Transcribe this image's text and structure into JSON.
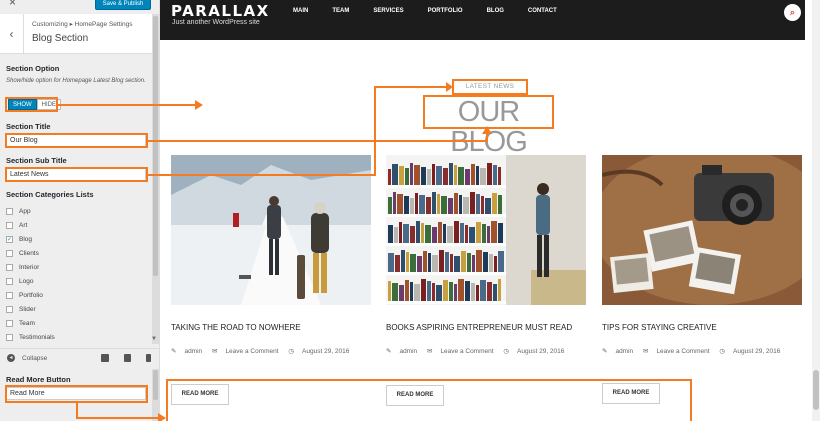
{
  "sidebar": {
    "close_icon": "close-icon",
    "save_label": "Save & Publish",
    "breadcrumb": "Customizing ▸ HomePage Settings",
    "section_title": "Blog Section",
    "section_option_label": "Section Option",
    "section_option_desc": "Show/hide option for Homepage Latest Blog section.",
    "toggle_show": "SHOW",
    "toggle_hide": "HIDE",
    "section_title_label": "Section Title",
    "section_title_value": "Our Blog",
    "section_subtitle_label": "Section Sub Title",
    "section_subtitle_value": "Latest News",
    "categories_label": "Section Categories Lists",
    "categories": [
      {
        "label": "App",
        "checked": false
      },
      {
        "label": "Art",
        "checked": false
      },
      {
        "label": "Blog",
        "checked": true
      },
      {
        "label": "Clients",
        "checked": false
      },
      {
        "label": "Interior",
        "checked": false
      },
      {
        "label": "Logo",
        "checked": false
      },
      {
        "label": "Portfolio",
        "checked": false
      },
      {
        "label": "Slider",
        "checked": false
      },
      {
        "label": "Team",
        "checked": false
      },
      {
        "label": "Testimonials",
        "checked": false
      }
    ],
    "collapse_label": "Collapse",
    "read_more_label": "Read More Button",
    "read_more_value": "Read More"
  },
  "preview": {
    "brand": "PARALLAX",
    "tagline": "Just another WordPress site",
    "menu": [
      "MAIN",
      "TEAM",
      "SERVICES",
      "PORTFOLIO",
      "BLOG",
      "CONTACT"
    ],
    "search_icon": "search-icon",
    "subtitle": "LATEST NEWS",
    "title": "OUR BLOG",
    "posts": [
      {
        "title": "TAKING THE ROAD TO NOWHERE",
        "author": "admin",
        "comments": "Leave a Comment",
        "date": "August 29, 2016",
        "button": "READ MORE"
      },
      {
        "title": "BOOKS ASPIRING ENTREPRENEUR MUST READ",
        "author": "admin",
        "comments": "Leave a Comment",
        "date": "August 29, 2016",
        "button": "READ MORE"
      },
      {
        "title": "TIPS FOR STAYING CREATIVE",
        "author": "admin",
        "comments": "Leave a Comment",
        "date": "August 29, 2016",
        "button": "READ MORE"
      }
    ]
  },
  "colors": {
    "accent": "#0085ba",
    "highlight": "#f57b20",
    "navbar": "#1c1c1c"
  }
}
